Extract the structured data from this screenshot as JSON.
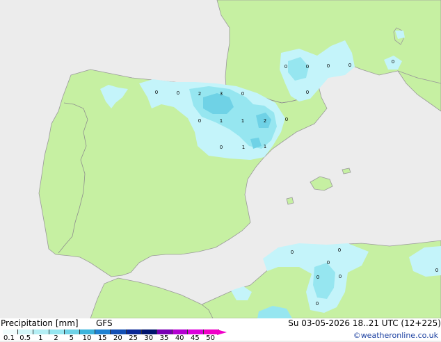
{
  "map": {
    "colors": {
      "sea": "#ececec",
      "land": "#c6f0a2",
      "coast": "#9a9a9a",
      "border": "#8e8e8e",
      "precip_light": "#c4f4fa",
      "precip_mid": "#96e6f0",
      "precip_heavy": "#6fd2e6"
    },
    "point_values": [
      {
        "id": "p1",
        "value": "0"
      },
      {
        "id": "p2",
        "value": "0"
      },
      {
        "id": "p3",
        "value": "2"
      },
      {
        "id": "p4",
        "value": "3"
      },
      {
        "id": "p5",
        "value": "0"
      },
      {
        "id": "p6",
        "value": "0"
      },
      {
        "id": "p7",
        "value": "1"
      },
      {
        "id": "p8",
        "value": "1"
      },
      {
        "id": "p9",
        "value": "2"
      },
      {
        "id": "p10",
        "value": "0"
      },
      {
        "id": "p11",
        "value": "0"
      },
      {
        "id": "p12",
        "value": "1"
      },
      {
        "id": "p13",
        "value": "1"
      },
      {
        "id": "p14",
        "value": "0"
      },
      {
        "id": "p15",
        "value": "0"
      },
      {
        "id": "p16",
        "value": "0"
      },
      {
        "id": "p17",
        "value": "0"
      },
      {
        "id": "p18",
        "value": "0"
      },
      {
        "id": "p19",
        "value": "0"
      },
      {
        "id": "p20",
        "value": "0"
      },
      {
        "id": "p21",
        "value": "0"
      },
      {
        "id": "p22",
        "value": "0"
      },
      {
        "id": "p23",
        "value": "0"
      },
      {
        "id": "p24",
        "value": "0"
      },
      {
        "id": "p25",
        "value": "0"
      },
      {
        "id": "p26",
        "value": "0"
      }
    ]
  },
  "legend": {
    "title": "Precipitation [mm]",
    "model": "GFS",
    "datetime": "Su 03-05-2026 18..21 UTC (12+225)",
    "credit": "©weatheronline.co.uk",
    "ticks": [
      "0.1",
      "0.5",
      "1",
      "2",
      "5",
      "10",
      "15",
      "20",
      "25",
      "30",
      "35",
      "40",
      "45",
      "50"
    ],
    "swatches": [
      "#f0fcfc",
      "#d2f6f8",
      "#b4eef4",
      "#96e6f0",
      "#6fd2e6",
      "#3cb4dc",
      "#1e82d2",
      "#1450b4",
      "#0a2896",
      "#00146e",
      "#7800b4",
      "#b400d2",
      "#dc00dc",
      "#f000c8"
    ]
  }
}
